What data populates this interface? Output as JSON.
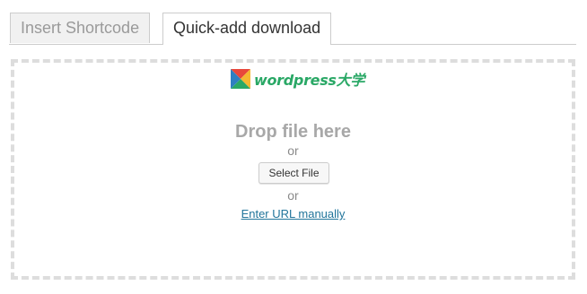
{
  "tabs": [
    {
      "label": "Insert Shortcode",
      "active": false
    },
    {
      "label": "Quick-add download",
      "active": true
    }
  ],
  "logo": {
    "text": "wordpress大学",
    "icon": "wordpress-daxue-logo-icon",
    "color": "#2aa866"
  },
  "upload": {
    "drop_title": "Drop file here",
    "or_1": "or",
    "select_button": "Select File",
    "or_2": "or",
    "url_link": "Enter URL manually"
  },
  "colors": {
    "link": "#21759b",
    "dashed_border": "#dddddd"
  }
}
